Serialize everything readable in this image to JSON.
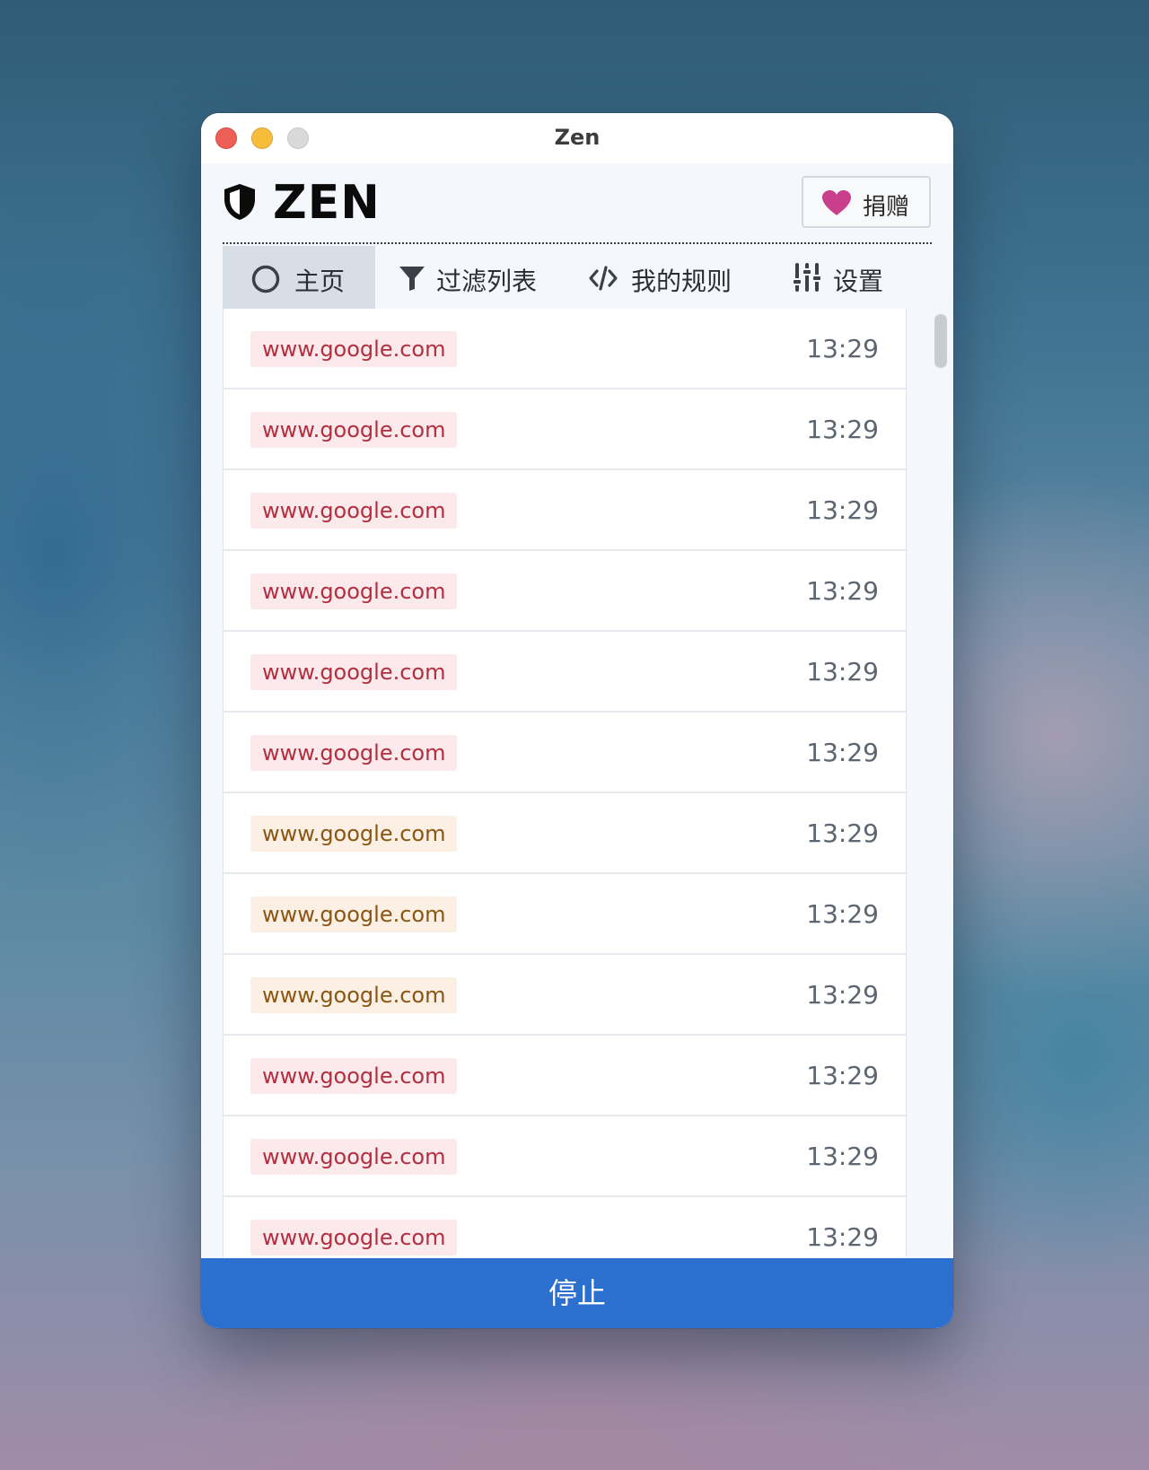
{
  "window": {
    "title": "Zen"
  },
  "header": {
    "logo_text": "ZEN",
    "donate_label": "捐赠"
  },
  "tabs": [
    {
      "label": "主页",
      "icon": "circle-icon",
      "active": true
    },
    {
      "label": "过滤列表",
      "icon": "filter-icon",
      "active": false
    },
    {
      "label": "我的规则",
      "icon": "code-icon",
      "active": false
    },
    {
      "label": "设置",
      "icon": "sliders-icon",
      "active": false
    }
  ],
  "requests": [
    {
      "host": "www.google.com",
      "time": "13:29",
      "status": "blocked"
    },
    {
      "host": "www.google.com",
      "time": "13:29",
      "status": "blocked"
    },
    {
      "host": "www.google.com",
      "time": "13:29",
      "status": "blocked"
    },
    {
      "host": "www.google.com",
      "time": "13:29",
      "status": "blocked"
    },
    {
      "host": "www.google.com",
      "time": "13:29",
      "status": "blocked"
    },
    {
      "host": "www.google.com",
      "time": "13:29",
      "status": "blocked"
    },
    {
      "host": "www.google.com",
      "time": "13:29",
      "status": "redirected"
    },
    {
      "host": "www.google.com",
      "time": "13:29",
      "status": "redirected"
    },
    {
      "host": "www.google.com",
      "time": "13:29",
      "status": "redirected"
    },
    {
      "host": "www.google.com",
      "time": "13:29",
      "status": "blocked"
    },
    {
      "host": "www.google.com",
      "time": "13:29",
      "status": "blocked"
    },
    {
      "host": "www.google.com",
      "time": "13:29",
      "status": "blocked"
    }
  ],
  "footer": {
    "stop_label": "停止"
  },
  "colors": {
    "accent": "#2b6fcf",
    "heart": "#c93f8c",
    "blocked_bg": "#fbe9eb",
    "blocked_text": "#b22f3f",
    "redirected_bg": "#fcefe4",
    "redirected_text": "#8a5614"
  }
}
